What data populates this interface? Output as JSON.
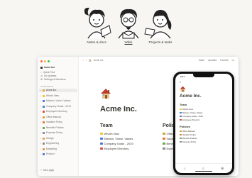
{
  "illustrations": [
    {
      "caption": "Notes & docs"
    },
    {
      "caption": "Wikis"
    },
    {
      "caption": "Projects & tasks"
    }
  ],
  "sidebar": {
    "workspace": "Acme Inc.",
    "quick": [
      "Quick Find",
      "All Updates",
      "Settings & Members"
    ],
    "section": "WORKSPACE",
    "items": [
      {
        "label": "Acme Inc.",
        "color": "#e0a44f",
        "active": true
      },
      {
        "label": "What's New",
        "color": "#f4c430"
      },
      {
        "label": "Mission, Vision, Values",
        "color": "#4a7bd0"
      },
      {
        "label": "Company Goals - 2019",
        "color": "#4a7bd0"
      },
      {
        "label": "Employee Directory",
        "color": "#d94b4b"
      },
      {
        "label": "Office Manual",
        "color": "#d9a13b"
      },
      {
        "label": "Vacation Policy",
        "color": "#e07a38"
      },
      {
        "label": "Benefits Policies",
        "color": "#6aa84f"
      },
      {
        "label": "Expense Policy",
        "color": "#8a8a8a"
      },
      {
        "label": "Design",
        "color": "#e0a44f"
      },
      {
        "label": "Engineering",
        "color": "#8a8a8a"
      },
      {
        "label": "Marketing",
        "color": "#d9a13b"
      },
      {
        "label": "Product",
        "color": "#4a7bd0"
      }
    ],
    "new_page": "New page"
  },
  "topbar": {
    "breadcrumb": "Acme Inc.",
    "actions": [
      "Share",
      "Updates",
      "Favorite",
      "•••"
    ]
  },
  "page": {
    "title": "Acme Inc.",
    "team_heading": "Team",
    "team_items": [
      {
        "label": "What's New",
        "color": "#f4c430"
      },
      {
        "label": "Mission, Vision, Values",
        "color": "#4a7bd0"
      },
      {
        "label": "Company Goals - 2019",
        "color": "#4a7bd0"
      },
      {
        "label": "Employee Directory",
        "color": "#d94b4b"
      }
    ],
    "policies_heading": "Policie",
    "policy_items": [
      {
        "label": "Office",
        "color": "#d9a13b"
      },
      {
        "label": "Vacatio",
        "color": "#e07a38"
      },
      {
        "label": "Benefit",
        "color": "#6aa84f"
      },
      {
        "label": "Expen",
        "color": "#8a8a8a"
      }
    ]
  },
  "phone": {
    "time": "9:41",
    "title": "Acme Inc.",
    "team_heading": "Team",
    "team_items": [
      "What's New",
      "Mission, Vision, Values",
      "Company Goals - 2019",
      "Employee Directory"
    ],
    "policies_heading": "Policies",
    "policy_items": [
      "Office Manual",
      "Vacation Policy",
      "Benefits Policies",
      "Expense Policy"
    ]
  }
}
